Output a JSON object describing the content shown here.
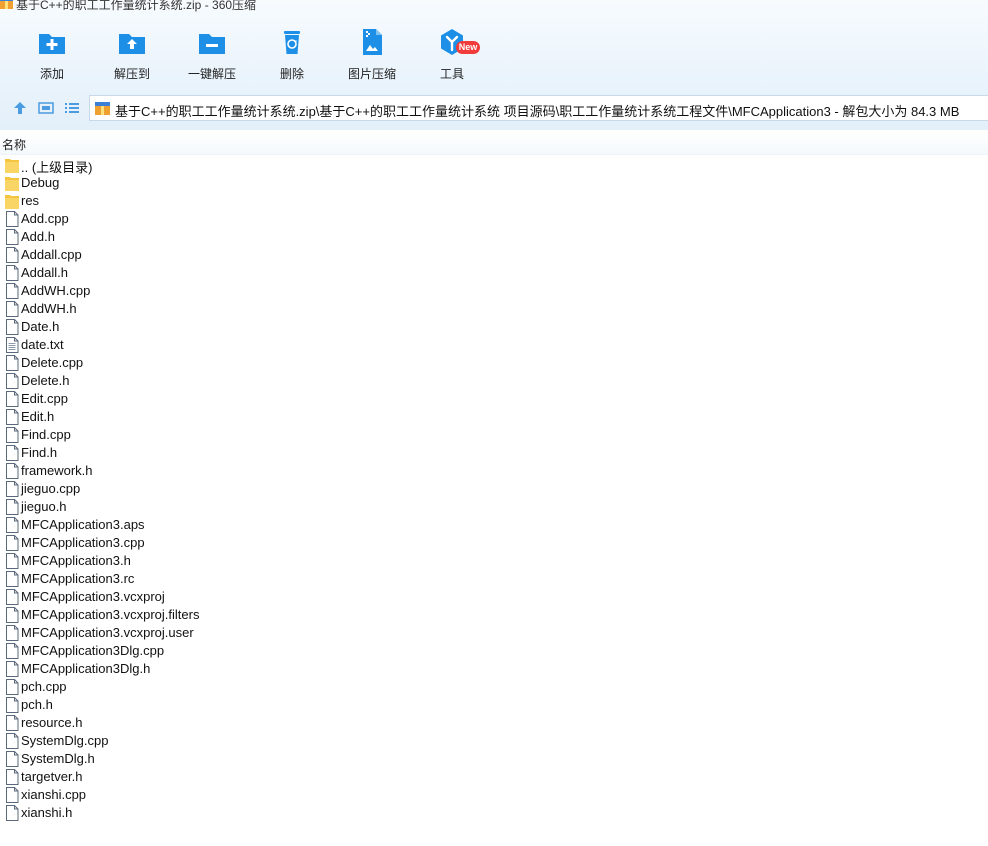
{
  "window": {
    "title": "基于C++的职工工作量统计系统.zip - 360压缩"
  },
  "toolbar": {
    "items": [
      {
        "label": "添加",
        "icon": "add-folder-icon"
      },
      {
        "label": "解压到",
        "icon": "extract-to-icon"
      },
      {
        "label": "一键解压",
        "icon": "one-click-extract-icon"
      },
      {
        "label": "删除",
        "icon": "recycle-bin-icon"
      },
      {
        "label": "图片压缩",
        "icon": "image-compress-icon"
      },
      {
        "label": "工具",
        "icon": "tools-icon"
      }
    ],
    "badge": "New"
  },
  "address": {
    "path": "基于C++的职工工作量统计系统.zip\\基于C++的职工工作量统计系统 项目源码\\职工工作量统计系统工程文件\\MFCApplication3 - 解包大小为 84.3 MB"
  },
  "list": {
    "column_name": "名称",
    "items": [
      {
        "name": ".. (上级目录)",
        "type": "folder"
      },
      {
        "name": "Debug",
        "type": "folder"
      },
      {
        "name": "res",
        "type": "folder"
      },
      {
        "name": "Add.cpp",
        "type": "file"
      },
      {
        "name": "Add.h",
        "type": "file"
      },
      {
        "name": "Addall.cpp",
        "type": "file"
      },
      {
        "name": "Addall.h",
        "type": "file"
      },
      {
        "name": "AddWH.cpp",
        "type": "file"
      },
      {
        "name": "AddWH.h",
        "type": "file"
      },
      {
        "name": "Date.h",
        "type": "file"
      },
      {
        "name": "date.txt",
        "type": "text"
      },
      {
        "name": "Delete.cpp",
        "type": "file"
      },
      {
        "name": "Delete.h",
        "type": "file"
      },
      {
        "name": "Edit.cpp",
        "type": "file"
      },
      {
        "name": "Edit.h",
        "type": "file"
      },
      {
        "name": "Find.cpp",
        "type": "file"
      },
      {
        "name": "Find.h",
        "type": "file"
      },
      {
        "name": "framework.h",
        "type": "file"
      },
      {
        "name": "jieguo.cpp",
        "type": "file"
      },
      {
        "name": "jieguo.h",
        "type": "file"
      },
      {
        "name": "MFCApplication3.aps",
        "type": "file"
      },
      {
        "name": "MFCApplication3.cpp",
        "type": "file"
      },
      {
        "name": "MFCApplication3.h",
        "type": "file"
      },
      {
        "name": "MFCApplication3.rc",
        "type": "file"
      },
      {
        "name": "MFCApplication3.vcxproj",
        "type": "file"
      },
      {
        "name": "MFCApplication3.vcxproj.filters",
        "type": "file"
      },
      {
        "name": "MFCApplication3.vcxproj.user",
        "type": "file"
      },
      {
        "name": "MFCApplication3Dlg.cpp",
        "type": "file"
      },
      {
        "name": "MFCApplication3Dlg.h",
        "type": "file"
      },
      {
        "name": "pch.cpp",
        "type": "file"
      },
      {
        "name": "pch.h",
        "type": "file"
      },
      {
        "name": "resource.h",
        "type": "file"
      },
      {
        "name": "SystemDlg.cpp",
        "type": "file"
      },
      {
        "name": "SystemDlg.h",
        "type": "file"
      },
      {
        "name": "targetver.h",
        "type": "file"
      },
      {
        "name": "xianshi.cpp",
        "type": "file"
      },
      {
        "name": "xianshi.h",
        "type": "file"
      }
    ]
  },
  "colors": {
    "accent": "#1e8fe6",
    "folder": "#f5c542",
    "badge": "#f23b3b"
  }
}
